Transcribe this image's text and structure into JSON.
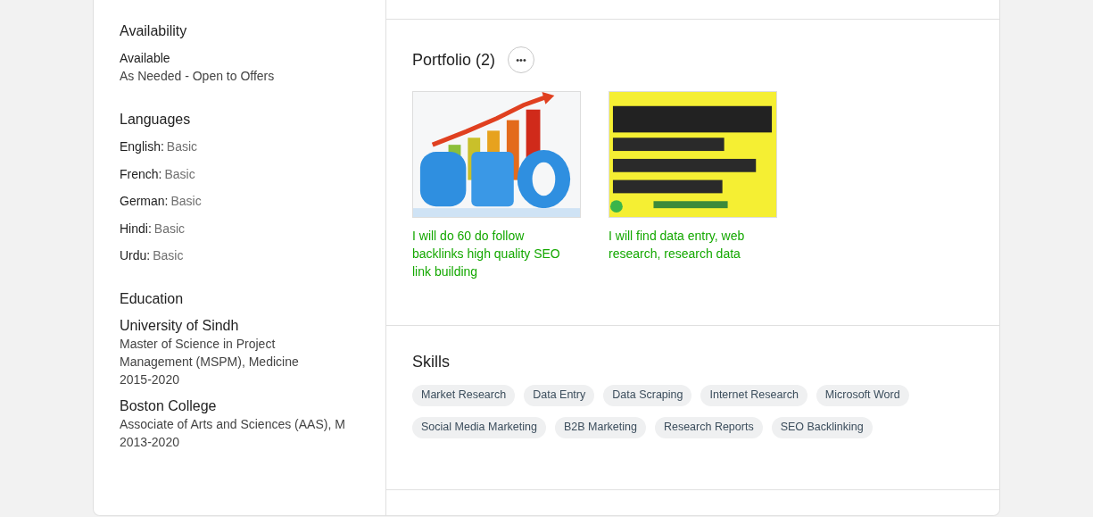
{
  "availability": {
    "title": "Availability",
    "status": "Available",
    "detail": "As Needed - Open to Offers"
  },
  "languages": {
    "title": "Languages",
    "items": [
      {
        "name": "English:",
        "level": "Basic"
      },
      {
        "name": "French:",
        "level": "Basic"
      },
      {
        "name": "German:",
        "level": "Basic"
      },
      {
        "name": "Hindi:",
        "level": "Basic"
      },
      {
        "name": "Urdu:",
        "level": "Basic"
      }
    ]
  },
  "education": {
    "title": "Education",
    "items": [
      {
        "school": "University of Sindh",
        "degree": "Master of Science in Project Management (MSPM), Medicine",
        "years": "2015-2020"
      },
      {
        "school": "Boston College",
        "degree": "Associate of Arts and Sciences (AAS), M",
        "years": "2013-2020"
      }
    ]
  },
  "portfolio": {
    "title": "Portfolio (2)",
    "more": "•••",
    "items": [
      {
        "kind": "picture",
        "title": "I will do 60 do follow backlinks high quality SEO link building"
      },
      {
        "kind": "picture",
        "title": "I will find data entry, web research, research data"
      }
    ]
  },
  "skills": {
    "title": "Skills",
    "items": [
      "Market Research",
      "Data Entry",
      "Data Scraping",
      "Internet Research",
      "Microsoft Word",
      "Social Media Marketing",
      "B2B Marketing",
      "Research Reports",
      "SEO Backlinking"
    ]
  }
}
